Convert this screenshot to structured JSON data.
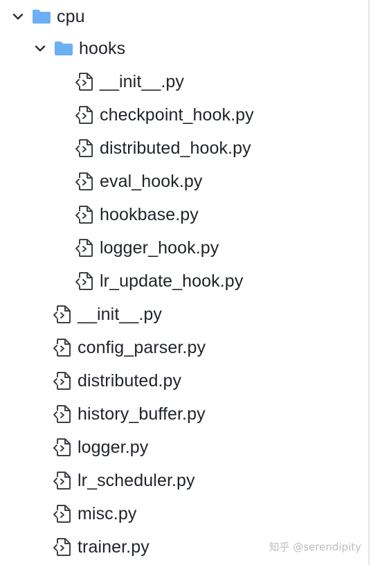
{
  "tree": {
    "root": {
      "label": "cpu",
      "icon": "folder-icon",
      "expanded": true
    },
    "hooks_folder": {
      "label": "hooks",
      "icon": "folder-icon",
      "expanded": true
    },
    "hooks_files": [
      "__init__.py",
      "checkpoint_hook.py",
      "distributed_hook.py",
      "eval_hook.py",
      "hookbase.py",
      "logger_hook.py",
      "lr_update_hook.py"
    ],
    "cpu_files": [
      "__init__.py",
      "config_parser.py",
      "distributed.py",
      "history_buffer.py",
      "logger.py",
      "lr_scheduler.py",
      "misc.py",
      "trainer.py"
    ]
  },
  "colors": {
    "folder": "#6bb0f5",
    "file_icon": "#3c4047",
    "text": "#1f2329",
    "chevron": "#2b2f36"
  },
  "watermark": "知乎 @serendipity"
}
